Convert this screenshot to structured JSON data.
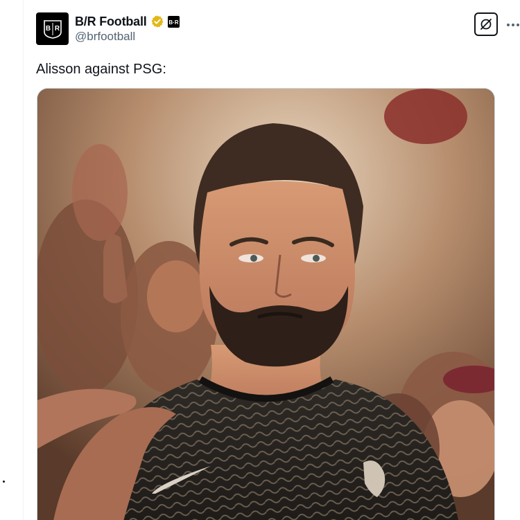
{
  "author": {
    "display_name": "B/R Football",
    "handle": "@brfootball",
    "avatar_text": "B/R",
    "affiliate_text": "B·R",
    "verified_color": "#e2b719"
  },
  "tweet": {
    "text": "Alisson against PSG:"
  },
  "icons": {
    "verified": "verified-badge-icon",
    "grok": "grok-icon",
    "more": "more-icon"
  },
  "colors": {
    "text_primary": "#0f1419",
    "text_secondary": "#536471",
    "border": "#cfd9de"
  }
}
